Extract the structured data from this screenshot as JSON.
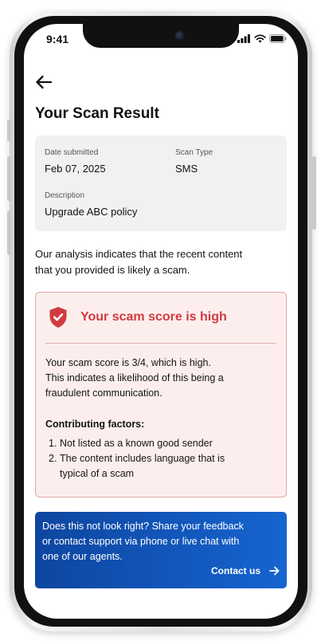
{
  "status_bar": {
    "time": "9:41",
    "icons": [
      "signal-icon",
      "wifi-icon",
      "battery-icon"
    ]
  },
  "header": {
    "back_icon": "back-arrow-icon",
    "title": "Your Scan Result"
  },
  "details": {
    "date_label": "Date submitted",
    "date_value": "Feb 07, 2025",
    "type_label": "Scan Type",
    "type_value": "SMS",
    "description_label": "Description",
    "description_value": "Upgrade ABC policy"
  },
  "analysis": {
    "line1": "Our analysis indicates that the recent content",
    "line2": "that you provided is likely a scam."
  },
  "alert": {
    "icon": "shield-alert-icon",
    "title": "Your scam score is high",
    "body_line1": "Your scam score is 3/4, which is high.",
    "body_line2": "This indicates a likelihood of this being a",
    "body_line3": "fraudulent communication.",
    "factors_heading": "Contributing factors:",
    "factors": [
      {
        "num": "1.",
        "line1": "Not listed as a known good sender",
        "line2": ""
      },
      {
        "num": "2.",
        "line1": "The content includes language that is",
        "line2": "typical of a scam"
      }
    ]
  },
  "contact": {
    "line1": "Does this not look right? Share your feedback",
    "line2": "or contact support via phone or live chat with",
    "line3": "one of our agents.",
    "link_label": "Contact us",
    "link_icon": "arrow-right-icon"
  },
  "colors": {
    "alert_red": "#d13a3f",
    "alert_bg": "#fdeeee",
    "panel_blue": "#1664d0",
    "card_gray": "#f1f1f3"
  }
}
